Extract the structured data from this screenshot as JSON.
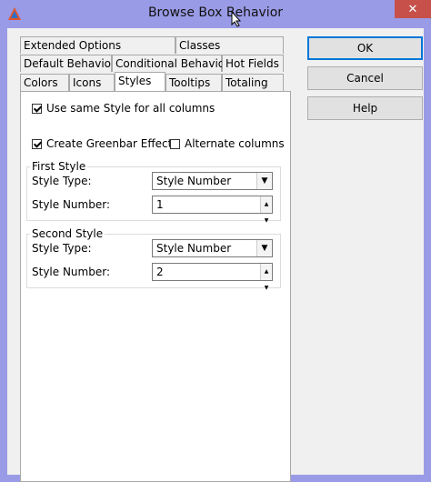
{
  "window": {
    "title": "Browse Box Behavior",
    "close_glyph": "✕",
    "background_color": "#9a9be6"
  },
  "tabs": {
    "row1": [
      "Extended Options",
      "Classes"
    ],
    "row2": [
      "Default Behavior",
      "Conditional Behavior",
      "Hot Fields"
    ],
    "row3": [
      "Colors",
      "Icons",
      "Styles",
      "Tooltips",
      "Totaling"
    ],
    "active": "Styles"
  },
  "buttons": {
    "ok": "OK",
    "cancel": "Cancel",
    "help": "Help"
  },
  "options": {
    "same_style_label": "Use same Style for all columns",
    "same_style_checked": true,
    "greenbar_label": "Create Greenbar Effect",
    "greenbar_checked": true,
    "alternate_label": "Alternate columns",
    "alternate_checked": false
  },
  "first_style": {
    "legend": "First Style",
    "type_label": "Style Type:",
    "type_value": "Style Number",
    "number_label": "Style Number:",
    "number_value": "1"
  },
  "second_style": {
    "legend": "Second Style",
    "type_label": "Style Type:",
    "type_value": "Style Number",
    "number_label": "Style Number:",
    "number_value": "2"
  },
  "icons": {
    "app": "clarion-triangle-icon",
    "close": "close-icon",
    "cursor": "mouse-pointer-icon"
  }
}
